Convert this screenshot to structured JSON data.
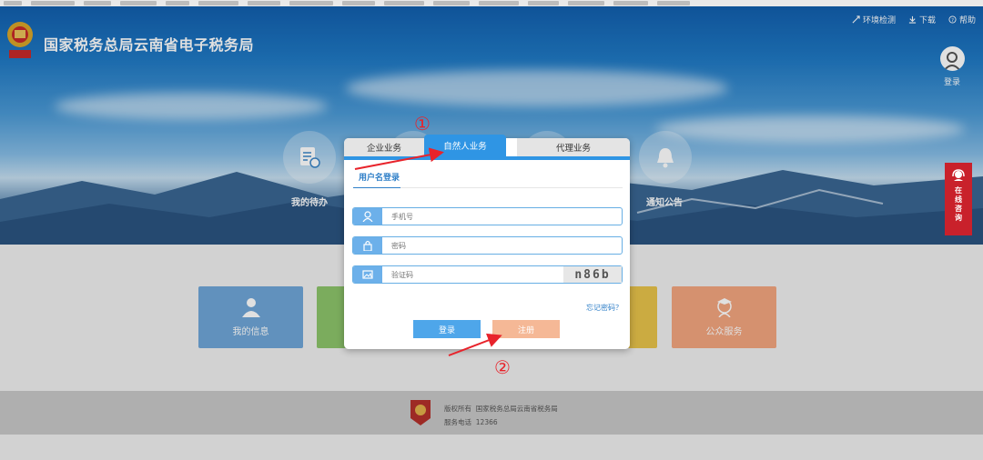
{
  "site": {
    "title": "国家税务总局云南省电子税务局"
  },
  "top_links": [
    {
      "label": "环境检测",
      "icon": "env-check-icon"
    },
    {
      "label": "下载",
      "icon": "download-icon"
    },
    {
      "label": "帮助",
      "icon": "help-icon"
    }
  ],
  "user": {
    "login_label": "登录"
  },
  "hero": [
    {
      "label": "我的待办",
      "icon": "todo-icon"
    },
    {
      "label": "通知公告",
      "icon": "bell-icon"
    }
  ],
  "cards": [
    {
      "label": "我的信息",
      "color": "#6fa6d8",
      "icon": "user-icon"
    },
    {
      "label": "公众服务",
      "color": "#f3a57f",
      "icon": "public-service-icon"
    }
  ],
  "consult": {
    "label": "在线咨询"
  },
  "dialog": {
    "tabs": {
      "enterprise": "企业业务",
      "natural": "自然人业务",
      "agent": "代理业务"
    },
    "subtab": "用户名登录",
    "phone_placeholder": "手机号",
    "password_placeholder": "密码",
    "captcha_placeholder": "验证码",
    "captcha_text": "n86b",
    "forgot": "忘记密码？",
    "login_button": "登录",
    "register_button": "注册"
  },
  "annotations": {
    "n1": "①",
    "n2": "②"
  },
  "footer": {
    "copyright_label": "版权所有",
    "copyright_value": "国家税务总局云南省税务局",
    "phone_label": "服务电话",
    "phone_value": "12366"
  },
  "colors": {
    "primary": "#2f95e4",
    "register": "#f5b896",
    "consult": "#c9212b",
    "annotation": "#e8232b"
  }
}
